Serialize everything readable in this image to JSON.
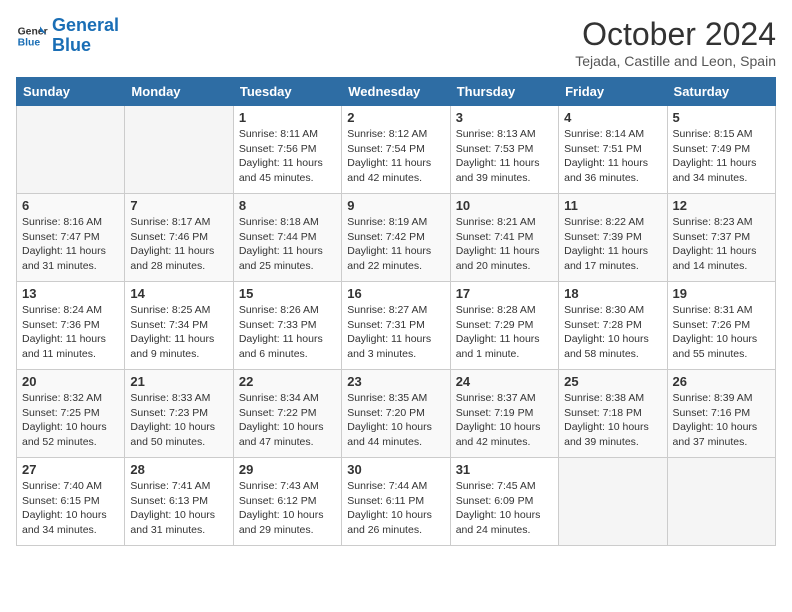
{
  "header": {
    "logo_general": "General",
    "logo_blue": "Blue",
    "month": "October 2024",
    "location": "Tejada, Castille and Leon, Spain"
  },
  "days_of_week": [
    "Sunday",
    "Monday",
    "Tuesday",
    "Wednesday",
    "Thursday",
    "Friday",
    "Saturday"
  ],
  "weeks": [
    [
      {
        "day": "",
        "info": ""
      },
      {
        "day": "",
        "info": ""
      },
      {
        "day": "1",
        "info": "Sunrise: 8:11 AM\nSunset: 7:56 PM\nDaylight: 11 hours and 45 minutes."
      },
      {
        "day": "2",
        "info": "Sunrise: 8:12 AM\nSunset: 7:54 PM\nDaylight: 11 hours and 42 minutes."
      },
      {
        "day": "3",
        "info": "Sunrise: 8:13 AM\nSunset: 7:53 PM\nDaylight: 11 hours and 39 minutes."
      },
      {
        "day": "4",
        "info": "Sunrise: 8:14 AM\nSunset: 7:51 PM\nDaylight: 11 hours and 36 minutes."
      },
      {
        "day": "5",
        "info": "Sunrise: 8:15 AM\nSunset: 7:49 PM\nDaylight: 11 hours and 34 minutes."
      }
    ],
    [
      {
        "day": "6",
        "info": "Sunrise: 8:16 AM\nSunset: 7:47 PM\nDaylight: 11 hours and 31 minutes."
      },
      {
        "day": "7",
        "info": "Sunrise: 8:17 AM\nSunset: 7:46 PM\nDaylight: 11 hours and 28 minutes."
      },
      {
        "day": "8",
        "info": "Sunrise: 8:18 AM\nSunset: 7:44 PM\nDaylight: 11 hours and 25 minutes."
      },
      {
        "day": "9",
        "info": "Sunrise: 8:19 AM\nSunset: 7:42 PM\nDaylight: 11 hours and 22 minutes."
      },
      {
        "day": "10",
        "info": "Sunrise: 8:21 AM\nSunset: 7:41 PM\nDaylight: 11 hours and 20 minutes."
      },
      {
        "day": "11",
        "info": "Sunrise: 8:22 AM\nSunset: 7:39 PM\nDaylight: 11 hours and 17 minutes."
      },
      {
        "day": "12",
        "info": "Sunrise: 8:23 AM\nSunset: 7:37 PM\nDaylight: 11 hours and 14 minutes."
      }
    ],
    [
      {
        "day": "13",
        "info": "Sunrise: 8:24 AM\nSunset: 7:36 PM\nDaylight: 11 hours and 11 minutes."
      },
      {
        "day": "14",
        "info": "Sunrise: 8:25 AM\nSunset: 7:34 PM\nDaylight: 11 hours and 9 minutes."
      },
      {
        "day": "15",
        "info": "Sunrise: 8:26 AM\nSunset: 7:33 PM\nDaylight: 11 hours and 6 minutes."
      },
      {
        "day": "16",
        "info": "Sunrise: 8:27 AM\nSunset: 7:31 PM\nDaylight: 11 hours and 3 minutes."
      },
      {
        "day": "17",
        "info": "Sunrise: 8:28 AM\nSunset: 7:29 PM\nDaylight: 11 hours and 1 minute."
      },
      {
        "day": "18",
        "info": "Sunrise: 8:30 AM\nSunset: 7:28 PM\nDaylight: 10 hours and 58 minutes."
      },
      {
        "day": "19",
        "info": "Sunrise: 8:31 AM\nSunset: 7:26 PM\nDaylight: 10 hours and 55 minutes."
      }
    ],
    [
      {
        "day": "20",
        "info": "Sunrise: 8:32 AM\nSunset: 7:25 PM\nDaylight: 10 hours and 52 minutes."
      },
      {
        "day": "21",
        "info": "Sunrise: 8:33 AM\nSunset: 7:23 PM\nDaylight: 10 hours and 50 minutes."
      },
      {
        "day": "22",
        "info": "Sunrise: 8:34 AM\nSunset: 7:22 PM\nDaylight: 10 hours and 47 minutes."
      },
      {
        "day": "23",
        "info": "Sunrise: 8:35 AM\nSunset: 7:20 PM\nDaylight: 10 hours and 44 minutes."
      },
      {
        "day": "24",
        "info": "Sunrise: 8:37 AM\nSunset: 7:19 PM\nDaylight: 10 hours and 42 minutes."
      },
      {
        "day": "25",
        "info": "Sunrise: 8:38 AM\nSunset: 7:18 PM\nDaylight: 10 hours and 39 minutes."
      },
      {
        "day": "26",
        "info": "Sunrise: 8:39 AM\nSunset: 7:16 PM\nDaylight: 10 hours and 37 minutes."
      }
    ],
    [
      {
        "day": "27",
        "info": "Sunrise: 7:40 AM\nSunset: 6:15 PM\nDaylight: 10 hours and 34 minutes."
      },
      {
        "day": "28",
        "info": "Sunrise: 7:41 AM\nSunset: 6:13 PM\nDaylight: 10 hours and 31 minutes."
      },
      {
        "day": "29",
        "info": "Sunrise: 7:43 AM\nSunset: 6:12 PM\nDaylight: 10 hours and 29 minutes."
      },
      {
        "day": "30",
        "info": "Sunrise: 7:44 AM\nSunset: 6:11 PM\nDaylight: 10 hours and 26 minutes."
      },
      {
        "day": "31",
        "info": "Sunrise: 7:45 AM\nSunset: 6:09 PM\nDaylight: 10 hours and 24 minutes."
      },
      {
        "day": "",
        "info": ""
      },
      {
        "day": "",
        "info": ""
      }
    ]
  ]
}
